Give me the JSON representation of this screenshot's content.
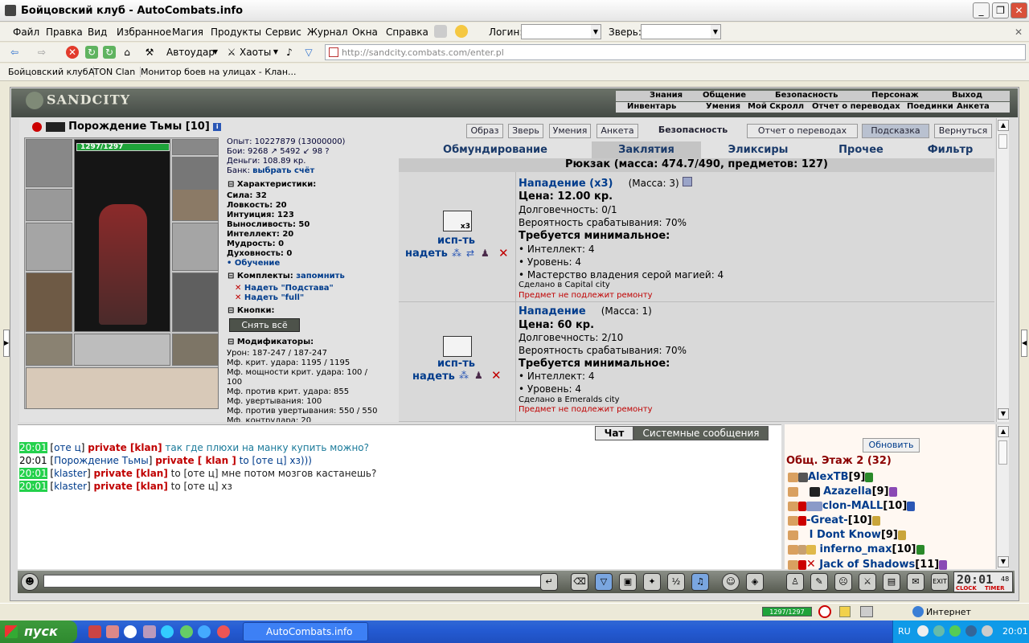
{
  "window": {
    "title": "Бойцовский клуб - AutoCombats.info"
  },
  "menu": {
    "items": [
      "Файл",
      "Правка",
      "Вид",
      "Избранное",
      "Магия",
      "Продукты",
      "Сервис",
      "Журнал",
      "Окна",
      "Справка"
    ],
    "login_label": "Логин:",
    "pet_label": "Зверь:"
  },
  "toolbar": {
    "autostrike": "Автоудар",
    "chaotic": "Хаоты",
    "url": "http://sandcity.combats.com/enter.pl"
  },
  "bookmarks": [
    "Бойцовский клуб",
    "ATON Clan",
    "Монитор боев на улицах - Клан..."
  ],
  "game": {
    "logo": "SANDCITY",
    "nav_top": [
      "Знания",
      "Общение",
      "Безопасность",
      "Персонаж",
      "Выход"
    ],
    "nav_bottom": [
      "Инвентарь",
      "Умения",
      "Мой Скролл",
      "Отчет о переводах",
      "Поединки",
      "Анкета"
    ]
  },
  "character": {
    "name": "Порождение Тьмы [10]",
    "hp": "1297/1297",
    "exp": "Опыт: 10227879 (13000000)",
    "fights": "Бои: 9268 ↗ 5492 ↙ 98 ?",
    "money": "Деньги: 108.89 кр.",
    "bank_label": "Банк:",
    "bank_link": "выбрать счёт",
    "sections": {
      "stats": "Характеристики:",
      "sets": "Комплекты:",
      "remember": "запомнить",
      "buttons": "Кнопки:",
      "mods": "Модификаторы:"
    },
    "stats": [
      "Сила: 32",
      "Ловкость: 20",
      "Интуиция: 123",
      "Выносливость: 50",
      "Интеллект: 20",
      "Мудрость: 0",
      "Духовность: 0"
    ],
    "training": "• Обучение",
    "sets": [
      "Надеть \"Подстава\"",
      "Надеть \"full\""
    ],
    "undress_all": "Снять всё",
    "mods": [
      "Урон: 187-247 / 187-247",
      "Мф. крит. удара: 1195 / 1195",
      "Мф. мощности крит. удара: 100 /",
      "100",
      "Мф. против крит. удара: 855",
      "Мф. увертывания: 100",
      "Мф. против увертывания: 550 / 550",
      "Мф. контрудара: 20"
    ]
  },
  "top_buttons": [
    "Образ",
    "Зверь",
    "Умения",
    "Анкета",
    "Безопасность",
    "Отчет о переводах",
    "Подсказка",
    "Вернуться"
  ],
  "inv_tabs": [
    "Обмундирование",
    "Заклятия",
    "Эликсиры",
    "Прочее",
    "Фильтр"
  ],
  "inventory_header": "Рюкзак (масса: 474.7/490, предметов: 127)",
  "items": [
    {
      "title": "Нападение (x3)",
      "mass": "(Масса: 3)",
      "price": "Цена: 12.00 кр.",
      "durability": "Долговечность: 0/1",
      "chance": "Вероятность срабатывания: 70%",
      "req_title": "Требуется минимальное:",
      "reqs": [
        "• Интеллект: 4",
        "• Уровень: 4",
        "• Мастерство владения серой магией: 4"
      ],
      "made": "Сделано в Capital city",
      "repair": "Предмет не подлежит ремонту",
      "use": "исп-ть",
      "wear": "надеть",
      "count": "x3"
    },
    {
      "title": "Нападение",
      "mass": "(Масса: 1)",
      "price": "Цена: 60 кр.",
      "durability": "Долговечность: 2/10",
      "chance": "Вероятность срабатывания: 70%",
      "req_title": "Требуется минимальное:",
      "reqs": [
        "• Интеллект: 4",
        "• Уровень: 4"
      ],
      "made": "Сделано в Emeralds city",
      "repair": "Предмет не подлежит ремонту",
      "use": "исп-ть",
      "wear": "надеть"
    }
  ],
  "chat": {
    "tabs": [
      "Чат",
      "Системные сообщения"
    ],
    "lines": [
      {
        "time": "20:01",
        "hl": true,
        "from": "оте ц",
        "priv": "private [klan]",
        "text": "так где плюхи на манку купить можно?"
      },
      {
        "time": "20:01",
        "hl": false,
        "from": "Порождение Тьмы",
        "priv": "private [ klan ]",
        "text": "to [оте ц] хз)))"
      },
      {
        "time": "20:01",
        "hl": true,
        "from": "klaster",
        "priv": "private [klan]",
        "text": "to [оте ц] мне потом мозгов кастанешь?"
      },
      {
        "time": "20:01",
        "hl": true,
        "from": "klaster",
        "priv": "private [klan]",
        "text": "to [оте ц] хз"
      }
    ]
  },
  "online": {
    "refresh": "Обновить",
    "title": "Общ. Этаж 2 (32)",
    "users": [
      {
        "name": "AlexTB",
        "lvl": "[9]"
      },
      {
        "name": "Azazella",
        "lvl": "[9]"
      },
      {
        "name": "clon-MALL",
        "lvl": "[10]"
      },
      {
        "name": "-Great-",
        "lvl": "[10]"
      },
      {
        "name": "I Dont Know",
        "lvl": "[9]"
      },
      {
        "name": "inferno_max",
        "lvl": "[10]"
      },
      {
        "name": "Jack of Shadows",
        "lvl": "[11]"
      }
    ]
  },
  "clock": {
    "time": "20:01",
    "sec": "48",
    "labels": [
      "CLOCK",
      "TIMER"
    ]
  },
  "statusbar": {
    "hp": "1297/1297",
    "zone": "Интернет"
  },
  "taskbar": {
    "start": "пуск",
    "task": "AutoCombats.info",
    "lang": "RU",
    "time": "20:01"
  }
}
